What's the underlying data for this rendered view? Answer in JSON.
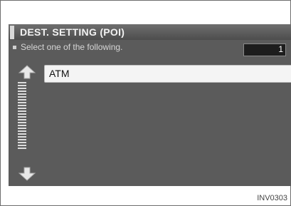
{
  "header": {
    "title": "DEST. SETTING (POI)"
  },
  "prompt": {
    "text": "Select one of the following."
  },
  "counter": {
    "value": "1"
  },
  "list": {
    "items": [
      {
        "label": "ATM"
      }
    ]
  },
  "caption": "INV0303",
  "icons": {
    "scroll_up": "arrow-up-icon",
    "scroll_down": "arrow-down-icon",
    "scrollbar": "scroll-track"
  }
}
